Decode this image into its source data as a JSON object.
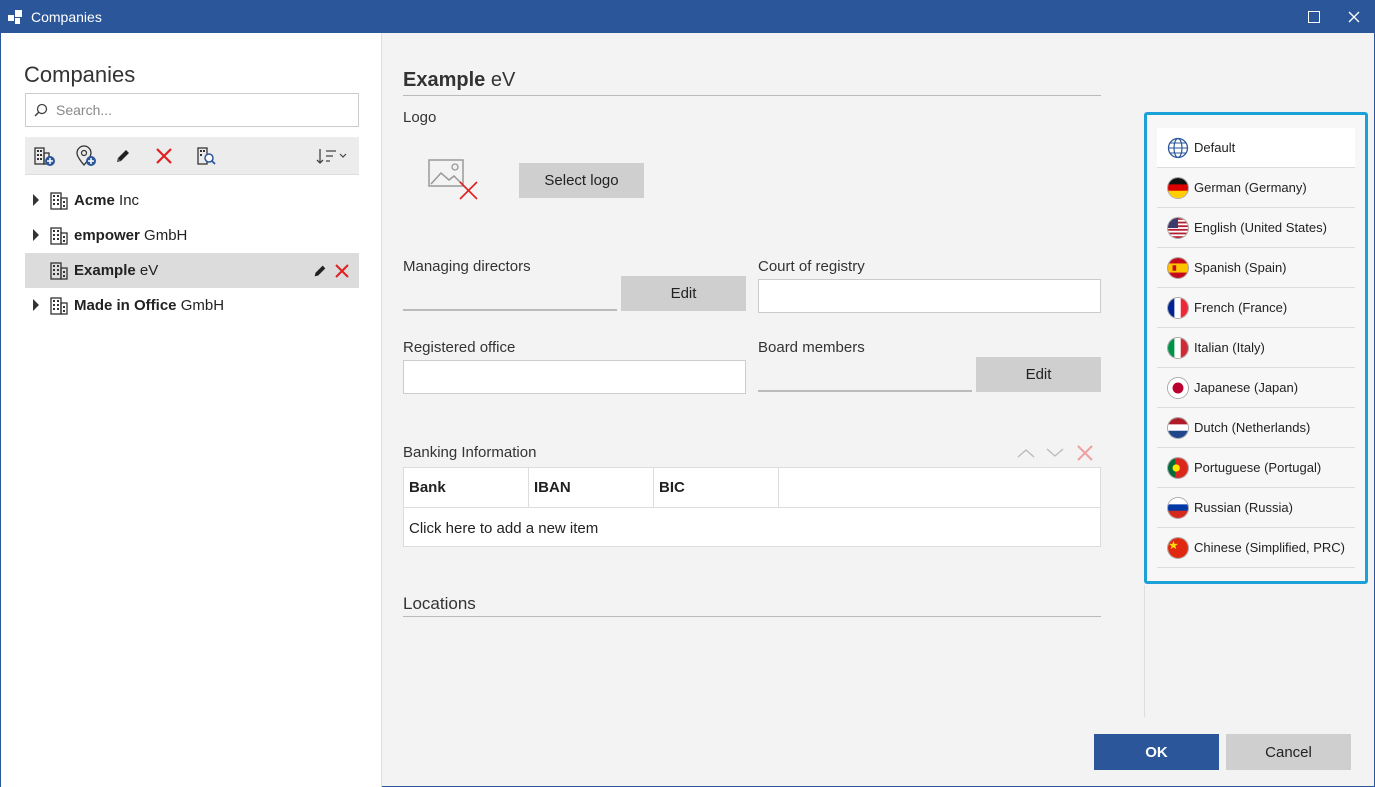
{
  "window": {
    "title": "Companies",
    "maximize_icon": "maximize-icon",
    "close_icon": "close-icon"
  },
  "sidebar": {
    "heading": "Companies",
    "search": {
      "placeholder": "Search...",
      "value": ""
    },
    "toolbar": [
      "add-company-icon",
      "add-location-icon",
      "edit-icon",
      "delete-icon",
      "search-company-icon",
      "sort-icon"
    ],
    "items": [
      {
        "bold": "Acme",
        "rest": " Inc"
      },
      {
        "bold": "empower",
        "rest": " GmbH"
      },
      {
        "bold": "Example",
        "rest": " eV",
        "selected": true
      },
      {
        "bold": "Made in Office",
        "rest": " GmbH"
      }
    ]
  },
  "main": {
    "heading_bold": "Example",
    "heading_rest": " eV",
    "logo_label": "Logo",
    "select_logo": "Select logo",
    "managing_directors": "Managing directors",
    "court_of_registry": "Court of registry",
    "registered_office": "Registered office",
    "board_members": "Board members",
    "edit": "Edit",
    "banking": {
      "label": "Banking Information",
      "columns": [
        "Bank",
        "IBAN",
        "BIC"
      ],
      "add_item": "Click here to add a new item"
    },
    "locations": "Locations"
  },
  "languages": [
    {
      "name": "Default",
      "flag": "globe",
      "active": true
    },
    {
      "name": "German (Germany)",
      "flag": "de"
    },
    {
      "name": "English (United States)",
      "flag": "us"
    },
    {
      "name": "Spanish (Spain)",
      "flag": "es"
    },
    {
      "name": "French (France)",
      "flag": "fr"
    },
    {
      "name": "Italian (Italy)",
      "flag": "it"
    },
    {
      "name": "Japanese (Japan)",
      "flag": "jp"
    },
    {
      "name": "Dutch (Netherlands)",
      "flag": "nl"
    },
    {
      "name": "Portuguese (Portugal)",
      "flag": "pt"
    },
    {
      "name": "Russian (Russia)",
      "flag": "ru"
    },
    {
      "name": "Chinese (Simplified, PRC)",
      "flag": "cn"
    }
  ],
  "footer": {
    "ok": "OK",
    "cancel": "Cancel"
  },
  "colors": {
    "accent": "#2b579a",
    "highlight": "#1ba1d8",
    "delete": "#e02020"
  }
}
